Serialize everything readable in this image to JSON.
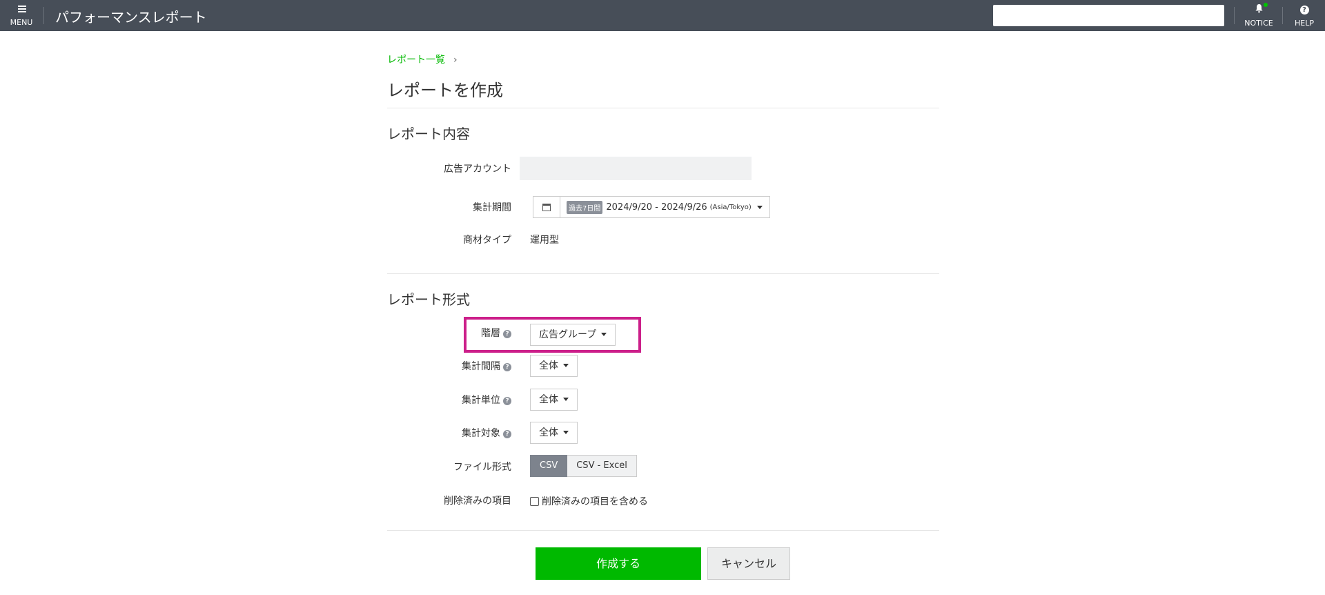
{
  "topbar": {
    "menu_label": "MENU",
    "app_title": "パフォーマンスレポート",
    "search_value": "",
    "notice_label": "NOTICE",
    "help_label": "HELP",
    "help_glyph": "?"
  },
  "breadcrumb": {
    "link": "レポート一覧",
    "separator": "›"
  },
  "page_title": "レポートを作成",
  "report_content": {
    "section_title": "レポート内容",
    "account_label": "広告アカウント",
    "account_value": "",
    "period_label": "集計期間",
    "period_badge": "過去7日間",
    "period_range": "2024/9/20 - 2024/9/26",
    "period_tz": "(Asia/Tokyo)",
    "material_label": "商材タイプ",
    "material_value": "運用型"
  },
  "report_format": {
    "section_title": "レポート形式",
    "help_glyph": "?",
    "level_label": "階層",
    "level_value": "広告グループ",
    "interval_label": "集計間隔",
    "interval_value": "全体",
    "unit_label": "集計単位",
    "unit_value": "全体",
    "target_label": "集計対象",
    "target_value": "全体",
    "file_label": "ファイル形式",
    "file_options": [
      "CSV",
      "CSV - Excel"
    ],
    "deleted_label": "削除済みの項目",
    "deleted_checkbox_label": "削除済みの項目を含める"
  },
  "actions": {
    "create": "作成する",
    "cancel": "キャンセル"
  },
  "colors": {
    "topbar": "#474e58",
    "accent_green": "#00b900",
    "highlight": "#cc1f8a"
  }
}
